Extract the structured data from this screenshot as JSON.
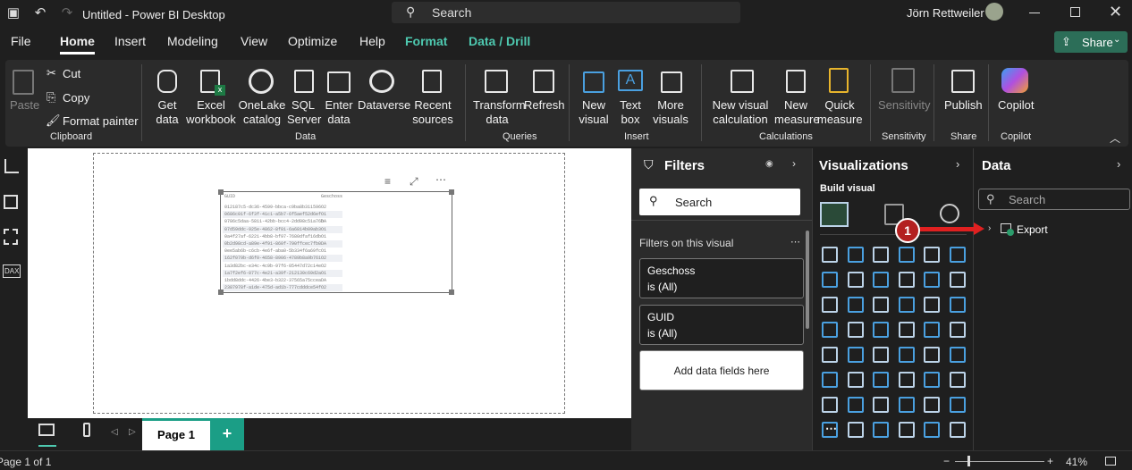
{
  "titlebar": {
    "title": "Untitled - Power BI Desktop",
    "search": "Search",
    "user": "Jörn Rettweiler"
  },
  "menu": {
    "file": "File",
    "home": "Home",
    "insert": "Insert",
    "modeling": "Modeling",
    "view": "View",
    "optimize": "Optimize",
    "help": "Help",
    "format": "Format",
    "data_drill": "Data / Drill",
    "share": "Share"
  },
  "ribbon": {
    "paste": "Paste",
    "cut": "Cut",
    "copy": "Copy",
    "format_painter": "Format painter",
    "clipboard": "Clipboard",
    "get_data": "Get data",
    "excel": "Excel workbook",
    "onelake": "OneLake catalog",
    "sql": "SQL Server",
    "enter_data": "Enter data",
    "dataverse": "Dataverse",
    "recent": "Recent sources",
    "data_group": "Data",
    "transform": "Transform data",
    "refresh": "Refresh",
    "queries": "Queries",
    "new_visual": "New visual",
    "text_box": "Text box",
    "more_visuals": "More visuals",
    "insert_group": "Insert",
    "new_visual_calc": "New visual calculation",
    "new_measure": "New measure",
    "quick_measure": "Quick measure",
    "calculations": "Calculations",
    "sensitivity": "Sensitivity",
    "sensitivity_group": "Sensitivity",
    "publish": "Publish",
    "share_group": "Share",
    "copilot": "Copilot",
    "copilot_group": "Copilot"
  },
  "table_visual": {
    "headers": [
      "GUID",
      "Geschoss"
    ],
    "rows": [
      [
        "012187c5-dc36-4599-bbca-c9ba8b311596",
        "O2"
      ],
      [
        "0686c01f-6f3f-41c1-a5b7-6f5aef52d6ef",
        "O1"
      ],
      [
        "0786c5daa-5811-42bb-bcc4-2dd98c51a76b",
        "DA"
      ],
      [
        "07d59ddc-925e-4862-8f81-6a6814b09ab3",
        "O1"
      ],
      [
        "0a4f27af-6221-4bb8-bf97-7680dfaf16db",
        "O1"
      ],
      [
        "0b2d98cd-a89e-4f91-860f-790ffcec7fb0",
        "DA"
      ],
      [
        "0ee5ab6b-c6cb-4e6f-aba0-5b334f6a69fc",
        "O1"
      ],
      [
        "162f079b-d6f0-4658-8906-4789b8a9b761",
        "O2"
      ],
      [
        "1a3d82bc-e34c-4c9b-97f6-05447d72c14e",
        "O2"
      ],
      [
        "1a7f2ef6-077c-4e21-a39f-212130c69d2a",
        "O1"
      ],
      [
        "1bdd8ddc-4426-4be3-b322-37565a75ccea",
        "DA"
      ],
      [
        "2387978f-a1de-475d-ad1b-777cdddce54f",
        "O2"
      ]
    ]
  },
  "filters": {
    "title": "Filters",
    "search": "Search",
    "on_visual": "Filters on this visual",
    "cards": [
      {
        "field": "Geschoss",
        "value": "is (All)"
      },
      {
        "field": "GUID",
        "value": "is (All)"
      }
    ],
    "add_fields": "Add data fields here"
  },
  "visualizations": {
    "title": "Visualizations",
    "build": "Build visual"
  },
  "data_pane": {
    "title": "Data",
    "search": "Search",
    "table": "Export"
  },
  "annotation": {
    "badge": "1"
  },
  "pagetabs": {
    "page1": "Page 1",
    "add": "+"
  },
  "status": {
    "page": "Page 1 of 1",
    "zoom": "41%"
  },
  "colors": {
    "accent_green": "#4ec9b0",
    "share_btn": "#2c6e58",
    "page_tab": "#1b9e86",
    "callout": "#e02020"
  }
}
